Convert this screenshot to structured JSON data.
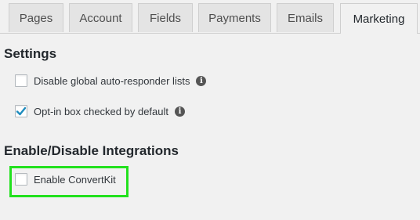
{
  "tabs": [
    {
      "label": "Pages"
    },
    {
      "label": "Account"
    },
    {
      "label": "Fields"
    },
    {
      "label": "Payments"
    },
    {
      "label": "Emails"
    },
    {
      "label": "Marketing",
      "active": true
    }
  ],
  "settings": {
    "heading": "Settings",
    "options": [
      {
        "label": "Disable global auto-responder lists",
        "checked": false,
        "icon": "info-icon"
      },
      {
        "label": "Opt-in box checked by default",
        "checked": true,
        "icon": "info-icon"
      }
    ]
  },
  "integrations": {
    "heading": "Enable/Disable Integrations",
    "options": [
      {
        "label": "Enable ConvertKit",
        "checked": false
      }
    ]
  },
  "colors": {
    "highlight": "#22e11e",
    "checkmark": "#1e8cbe"
  }
}
